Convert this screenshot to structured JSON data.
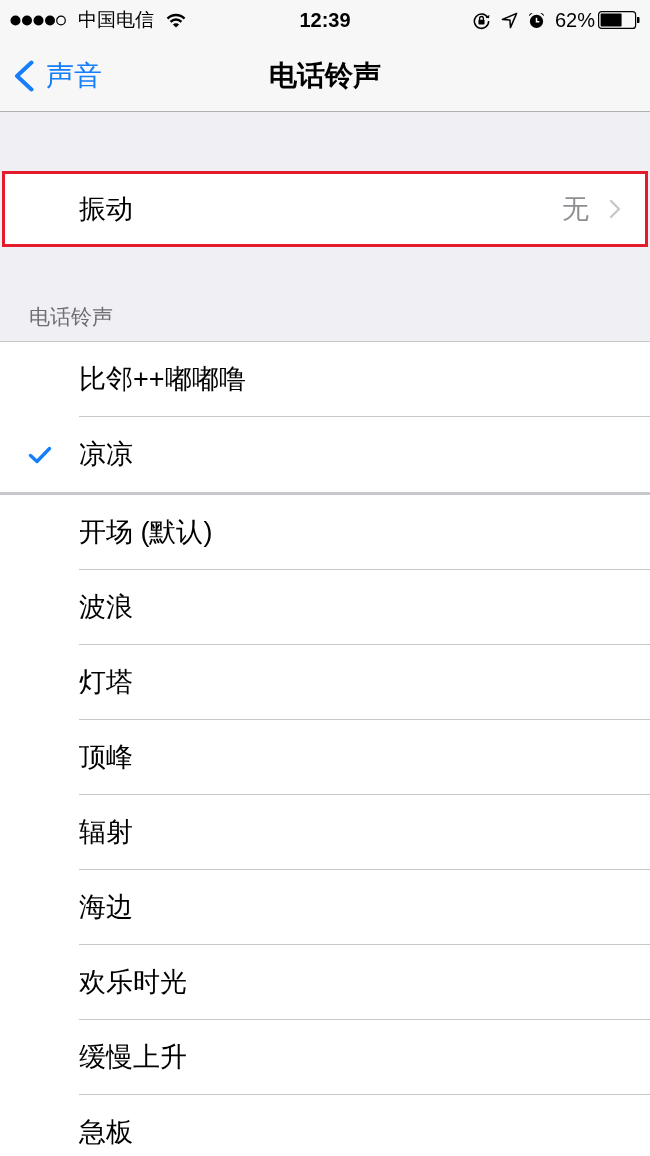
{
  "status_bar": {
    "carrier": "中国电信",
    "time": "12:39",
    "battery": "62%"
  },
  "nav_bar": {
    "back": "声音",
    "title": "电话铃声"
  },
  "vibration": {
    "label": "振动",
    "value": "无",
    "highlighted": true
  },
  "ringtones": {
    "header": "电话铃声",
    "groups": [
      {
        "items": [
          {
            "name": "比邻++嘟嘟噜",
            "selected": false
          },
          {
            "name": "凉凉",
            "selected": true
          }
        ]
      },
      {
        "items": [
          {
            "name": "开场 (默认)",
            "selected": false
          },
          {
            "name": "波浪",
            "selected": false
          },
          {
            "name": "灯塔",
            "selected": false
          },
          {
            "name": "顶峰",
            "selected": false
          },
          {
            "name": "辐射",
            "selected": false
          },
          {
            "name": "海边",
            "selected": false
          },
          {
            "name": "欢乐时光",
            "selected": false
          },
          {
            "name": "缓慢上升",
            "selected": false
          },
          {
            "name": "急板",
            "selected": false
          }
        ]
      }
    ]
  }
}
